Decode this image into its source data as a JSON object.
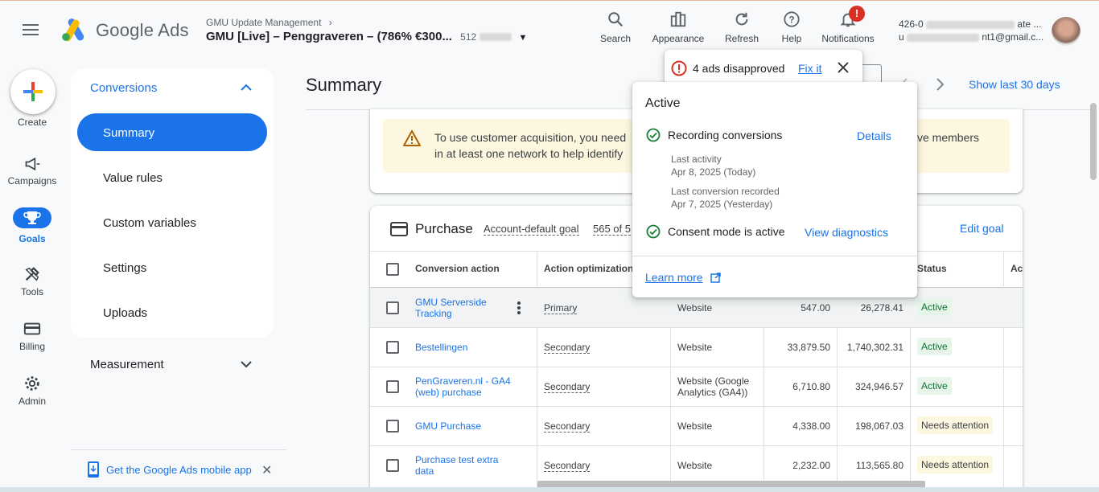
{
  "header": {
    "app_name": "Google Ads",
    "account_breadcrumb": "GMU Update Management",
    "account_name": "GMU [Live] – Penggraveren – (786% €300...",
    "account_id": "512",
    "tools": [
      {
        "label": "Search",
        "icon": "search-icon"
      },
      {
        "label": "Appearance",
        "icon": "appearance-icon"
      },
      {
        "label": "Refresh",
        "icon": "refresh-icon"
      },
      {
        "label": "Help",
        "icon": "help-icon"
      },
      {
        "label": "Notifications",
        "icon": "bell-icon"
      }
    ],
    "notifications_badge": "!",
    "user_line1": "426-0",
    "user_line1_suffix": "ate ...",
    "user_line2_prefix": "u",
    "user_line2_suffix": "nt1@gmail.c..."
  },
  "rail": {
    "create": "Create",
    "campaigns": "Campaigns",
    "goals": "Goals",
    "tools": "Tools",
    "billing": "Billing",
    "admin": "Admin"
  },
  "nav": {
    "section": "Conversions",
    "items": [
      "Summary",
      "Value rules",
      "Custom variables",
      "Settings",
      "Uploads"
    ],
    "selected": "Summary",
    "measurement": "Measurement",
    "mobile_app": "Get the Google Ads mobile app"
  },
  "main": {
    "title": "Summary",
    "show_last": "Show last 30 days",
    "warning_line1": "To use customer acquisition, you need",
    "warning_line2": "in at least one network to help identify",
    "warning_line1_end": "ve members",
    "goal_title": "Purchase",
    "goal_type": "Account-default goal",
    "goal_count": "565 of 5",
    "edit_goal": "Edit goal",
    "columns": {
      "action": "Conversion action",
      "optimization": "Action optimization",
      "status": "Status",
      "next": "Ac"
    },
    "rows": [
      {
        "name": "GMU Serverside Tracking",
        "opt": "Primary",
        "source": "Website",
        "conv": "547.00",
        "value": "26,278.41",
        "status": "Active"
      },
      {
        "name": "Bestellingen",
        "opt": "Secondary",
        "source": "Website",
        "conv": "33,879.50",
        "value": "1,740,302.31",
        "status": "Active"
      },
      {
        "name": "PenGraveren.nl - GA4 (web) purchase",
        "opt": "Secondary",
        "source": "Website (Google Analytics (GA4))",
        "conv": "6,710.80",
        "value": "324,946.57",
        "status": "Active"
      },
      {
        "name": "GMU Purchase",
        "opt": "Secondary",
        "source": "Website",
        "conv": "4,338.00",
        "value": "198,067.03",
        "status": "Needs attention"
      },
      {
        "name": "Purchase test extra data",
        "opt": "Secondary",
        "source": "Website",
        "conv": "2,232.00",
        "value": "113,565.80",
        "status": "Needs attention"
      }
    ]
  },
  "alert_popup": {
    "text": "4 ads disapproved",
    "fix": "Fix it"
  },
  "status_popup": {
    "title": "Active",
    "recording": "Recording conversions",
    "details": "Details",
    "last_activity_label": "Last activity",
    "last_activity_value": "Apr 8, 2025 (Today)",
    "last_conv_label": "Last conversion recorded",
    "last_conv_value": "Apr 7, 2025 (Yesterday)",
    "consent": "Consent mode is active",
    "view_diag": "View diagnostics",
    "learn_more": "Learn more"
  },
  "colors": {
    "primary": "#1a73e8",
    "active_green": "#137333",
    "warning_bg": "#fef7e0",
    "error_red": "#d93025"
  }
}
